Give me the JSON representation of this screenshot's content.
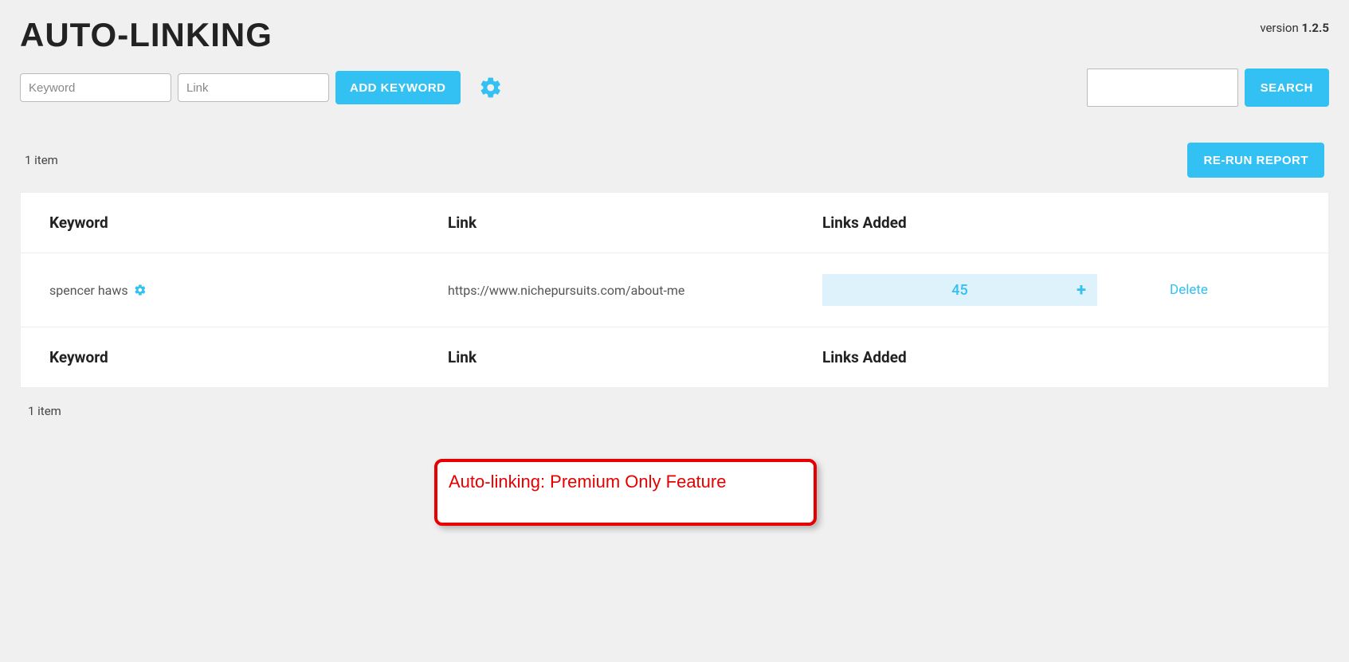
{
  "header": {
    "title": "AUTO-LINKING",
    "version_label": "version ",
    "version_value": "1.2.5"
  },
  "toolbar": {
    "keyword_placeholder": "Keyword",
    "link_placeholder": "Link",
    "add_button": "ADD KEYWORD",
    "search_button": "SEARCH"
  },
  "subbar": {
    "item_count": "1 item",
    "rerun_button": "RE-RUN REPORT"
  },
  "table": {
    "headers": {
      "keyword": "Keyword",
      "link": "Link",
      "links_added": "Links Added"
    },
    "row": {
      "keyword": "spencer haws",
      "link": "https://www.nichepursuits.com/about-me",
      "links_added": "45",
      "delete": "Delete"
    }
  },
  "footer_count": "1 item",
  "callout": "Auto-linking: Premium Only Feature"
}
